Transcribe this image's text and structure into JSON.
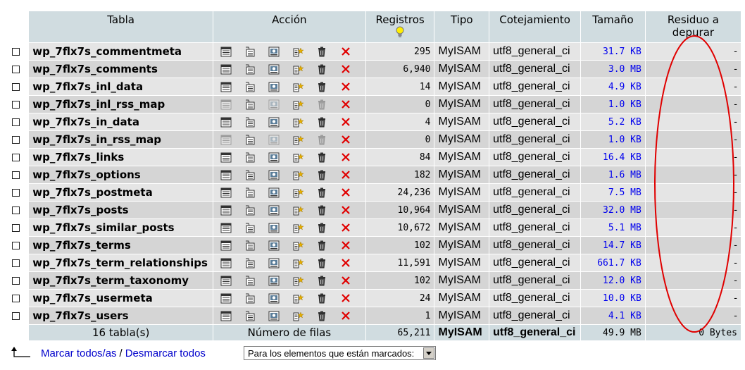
{
  "headers": {
    "tabla": "Tabla",
    "accion": "Acción",
    "registros": "Registros",
    "tipo": "Tipo",
    "cotejamiento": "Cotejamiento",
    "tamano": "Tamaño",
    "residuo": "Residuo a depurar"
  },
  "icons": [
    "browse-icon",
    "structure-icon",
    "search-icon",
    "insert-icon",
    "empty-icon",
    "drop-icon"
  ],
  "rows": [
    {
      "name": "wp_7flx7s_commentmeta",
      "records": "295",
      "type": "MyISAM",
      "collation": "utf8_general_ci",
      "size": "31.7 KB",
      "overhead": "-",
      "empty": false
    },
    {
      "name": "wp_7flx7s_comments",
      "records": "6,940",
      "type": "MyISAM",
      "collation": "utf8_general_ci",
      "size": "3.0 MB",
      "overhead": "-",
      "empty": false
    },
    {
      "name": "wp_7flx7s_inl_data",
      "records": "14",
      "type": "MyISAM",
      "collation": "utf8_general_ci",
      "size": "4.9 KB",
      "overhead": "-",
      "empty": false
    },
    {
      "name": "wp_7flx7s_inl_rss_map",
      "records": "0",
      "type": "MyISAM",
      "collation": "utf8_general_ci",
      "size": "1.0 KB",
      "overhead": "-",
      "empty": true
    },
    {
      "name": "wp_7flx7s_in_data",
      "records": "4",
      "type": "MyISAM",
      "collation": "utf8_general_ci",
      "size": "5.2 KB",
      "overhead": "-",
      "empty": false
    },
    {
      "name": "wp_7flx7s_in_rss_map",
      "records": "0",
      "type": "MyISAM",
      "collation": "utf8_general_ci",
      "size": "1.0 KB",
      "overhead": "-",
      "empty": true
    },
    {
      "name": "wp_7flx7s_links",
      "records": "84",
      "type": "MyISAM",
      "collation": "utf8_general_ci",
      "size": "16.4 KB",
      "overhead": "-",
      "empty": false
    },
    {
      "name": "wp_7flx7s_options",
      "records": "182",
      "type": "MyISAM",
      "collation": "utf8_general_ci",
      "size": "1.6 MB",
      "overhead": "-",
      "empty": false
    },
    {
      "name": "wp_7flx7s_postmeta",
      "records": "24,236",
      "type": "MyISAM",
      "collation": "utf8_general_ci",
      "size": "7.5 MB",
      "overhead": "-",
      "empty": false
    },
    {
      "name": "wp_7flx7s_posts",
      "records": "10,964",
      "type": "MyISAM",
      "collation": "utf8_general_ci",
      "size": "32.0 MB",
      "overhead": "-",
      "empty": false
    },
    {
      "name": "wp_7flx7s_similar_posts",
      "records": "10,672",
      "type": "MyISAM",
      "collation": "utf8_general_ci",
      "size": "5.1 MB",
      "overhead": "-",
      "empty": false
    },
    {
      "name": "wp_7flx7s_terms",
      "records": "102",
      "type": "MyISAM",
      "collation": "utf8_general_ci",
      "size": "14.7 KB",
      "overhead": "-",
      "empty": false
    },
    {
      "name": "wp_7flx7s_term_relationships",
      "records": "11,591",
      "type": "MyISAM",
      "collation": "utf8_general_ci",
      "size": "661.7 KB",
      "overhead": "-",
      "empty": false
    },
    {
      "name": "wp_7flx7s_term_taxonomy",
      "records": "102",
      "type": "MyISAM",
      "collation": "utf8_general_ci",
      "size": "12.0 KB",
      "overhead": "-",
      "empty": false
    },
    {
      "name": "wp_7flx7s_usermeta",
      "records": "24",
      "type": "MyISAM",
      "collation": "utf8_general_ci",
      "size": "10.0 KB",
      "overhead": "-",
      "empty": false
    },
    {
      "name": "wp_7flx7s_users",
      "records": "1",
      "type": "MyISAM",
      "collation": "utf8_general_ci",
      "size": "4.1 KB",
      "overhead": "-",
      "empty": false
    }
  ],
  "footer": {
    "tables": "16 tabla(s)",
    "rows_label": "Número de filas",
    "records": "65,211",
    "type": "MyISAM",
    "collation": "utf8_general_ci",
    "size": "49.9 MB",
    "overhead": "0 Bytes"
  },
  "bulk": {
    "check_all": "Marcar todos/as",
    "separator": "/",
    "uncheck_all": "Desmarcar todos",
    "with_selected": "Para los elementos que están marcados:"
  },
  "colors": {
    "header_bg": "#d0dce0",
    "row_light": "#e5e5e5",
    "row_dark": "#d5d5d5",
    "size_link": "#0000ee",
    "annotation": "#e00000"
  }
}
